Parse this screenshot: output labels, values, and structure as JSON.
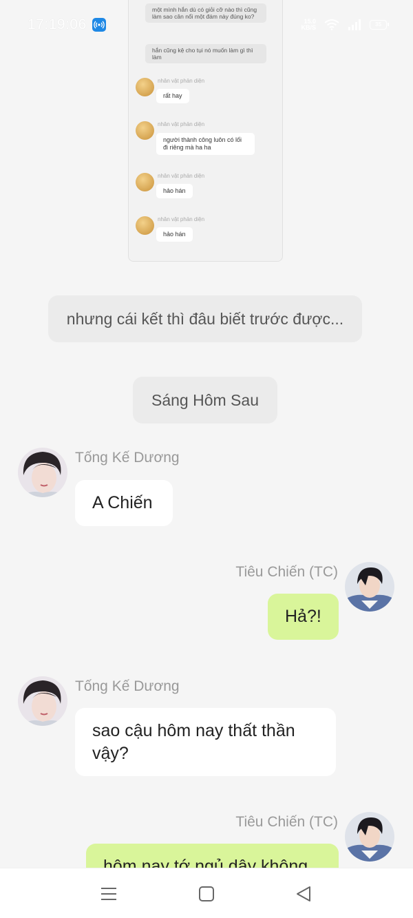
{
  "status_bar": {
    "time": "17:19:06",
    "speed_top": "15.0",
    "speed_bottom": "KB/S",
    "battery": "35",
    "icons": [
      "hotspot-icon",
      "wifi-icon",
      "signal-icon",
      "battery-icon"
    ]
  },
  "embedded_screenshot": {
    "top_messages": [
      "một mình hắn dù có giỏi cỡ nào thì cũng làm sao cân nổi một đám này đúng ko?",
      "hắn cũng kệ cho tụi nó muốn làm gì thì làm"
    ],
    "messages": [
      {
        "sender": "nhân vật phản diện",
        "text": "rất hay"
      },
      {
        "sender": "nhân vật phản diện",
        "text": "người thành công luôn có lối đi riêng mà ha ha"
      },
      {
        "sender": "nhân vật phản diện",
        "text": "hảo hán"
      },
      {
        "sender": "nhân vật phản diện",
        "text": "hảo hán"
      }
    ]
  },
  "narrations": [
    "nhưng cái kết thì đâu biết trước được...",
    "Sáng Hôm Sau"
  ],
  "chat": [
    {
      "sender": "Tống Kế Dương",
      "side": "left",
      "text": "A Chiến"
    },
    {
      "sender": "Tiêu Chiến (TC)",
      "side": "right",
      "text": "Hả?!"
    },
    {
      "sender": "Tống Kế Dương",
      "side": "left",
      "text": "sao cậu hôm nay thất thần vậy?"
    },
    {
      "sender": "Tiêu Chiến (TC)",
      "side": "right",
      "text": "hôm nay tớ ngủ dậy không"
    }
  ],
  "nav_bar": {
    "icons": [
      "menu-icon",
      "home-square-icon",
      "back-triangle-icon"
    ]
  },
  "colors": {
    "background": "#f5f5f5",
    "bubble_left": "#ffffff",
    "bubble_right": "#d9f59a",
    "narration_bg": "#ebebeb",
    "sender_text": "#999999"
  }
}
